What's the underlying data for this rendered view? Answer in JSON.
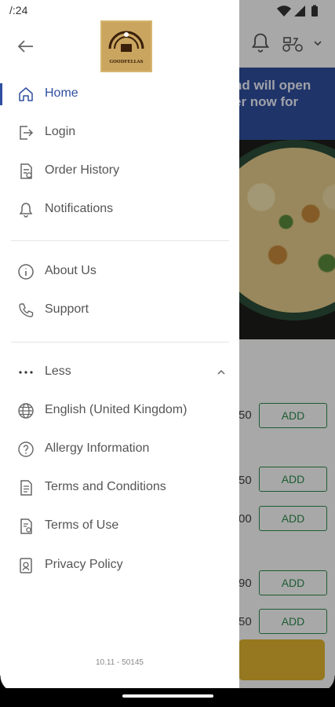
{
  "status_bar": {
    "time": "/:24"
  },
  "background_app": {
    "banner_text": "nd will open\ner now for",
    "rows": [
      {
        "price": "50",
        "add": "ADD"
      },
      {
        "price": "50",
        "add": "ADD"
      },
      {
        "price": "00",
        "add": "ADD"
      },
      {
        "price": "90",
        "add": "ADD"
      },
      {
        "price": "50",
        "add": "ADD"
      }
    ]
  },
  "drawer": {
    "logo_text": "GOODFELLAS",
    "nav_items": [
      {
        "label": "Home",
        "icon": "home-icon",
        "active": true
      },
      {
        "label": "Login",
        "icon": "login-icon"
      },
      {
        "label": "Order History",
        "icon": "order-history-icon"
      },
      {
        "label": "Notifications",
        "icon": "bell-icon"
      }
    ],
    "secondary_items": [
      {
        "label": "About Us",
        "icon": "info-icon"
      },
      {
        "label": "Support",
        "icon": "phone-icon"
      }
    ],
    "more_toggle": {
      "label": "Less",
      "icon": "more-dots-icon"
    },
    "more_items": [
      {
        "label": "English (United Kingdom)",
        "icon": "globe-icon"
      },
      {
        "label": "Allergy Information",
        "icon": "help-icon"
      },
      {
        "label": "Terms and Conditions",
        "icon": "document-icon"
      },
      {
        "label": "Terms of Use",
        "icon": "document-gear-icon"
      },
      {
        "label": "Privacy Policy",
        "icon": "privacy-icon"
      }
    ],
    "version": "10.11 - 50145"
  },
  "colors": {
    "accent": "#2f4fa0",
    "add_green": "#2e8c4e",
    "cart_yellow": "#e3b62f"
  }
}
